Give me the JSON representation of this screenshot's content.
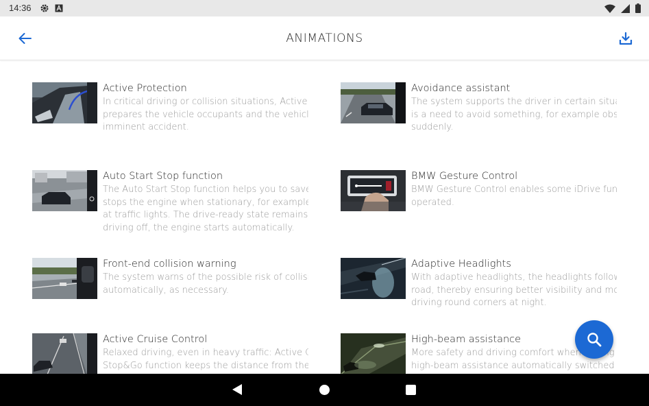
{
  "status_bar": {
    "time": "14:36",
    "left_icons": [
      "gear-icon",
      "app-a-icon"
    ],
    "right_icons": [
      "wifi-icon",
      "signal-icon",
      "battery-icon"
    ]
  },
  "app_bar": {
    "title": "ANIMATIONS",
    "back_icon": "arrow-left-icon",
    "download_icon": "download-icon"
  },
  "accent_color": "#1c69d4",
  "items": [
    {
      "title": "Active Protection",
      "description": "In critical driving or collision situations, Active Pro\nprepares the vehicle occupants and the vehicle fo\nimminent accident.",
      "thumbnail": "car-interior-seat-image"
    },
    {
      "title": "Avoidance assistant",
      "description": "The system supports the driver in certain situatio\nis a need to avoid something, for example obstac\nsuddenly.",
      "thumbnail": "car-on-road-image"
    },
    {
      "title": "Auto Start Stop function",
      "description": "The Auto Start Stop function helps you to save fu\nstops the engine when stationary, for example in\nat traffic lights. The drive-ready state remains sw\ndriving off, the engine starts automatically.",
      "thumbnail": "car-at-intersection-image"
    },
    {
      "title": "BMW Gesture Control",
      "description": "BMW Gesture Control enables some iDrive funct\noperated.",
      "thumbnail": "gesture-hand-display-image"
    },
    {
      "title": "Front-end collision warning",
      "description": "The system warns of the possible risk of collision\nautomatically, as necessary.",
      "thumbnail": "highway-traffic-image"
    },
    {
      "title": "Adaptive Headlights",
      "description": "With adaptive headlights, the headlights follow th\nroad, thereby ensuring better visibility and more\ndriving round corners at night.",
      "thumbnail": "night-headlights-image"
    },
    {
      "title": "Active Cruise Control",
      "description": "Relaxed driving, even in heavy traffic: Active Crui\nStop&Go function keeps the distance from the ve",
      "thumbnail": "cruise-road-image"
    },
    {
      "title": "High-beam assistance",
      "description": "More safety and driving comfort when driving at\nhigh-beam assistance automatically switched th",
      "thumbnail": "night-road-highbeam-image"
    }
  ],
  "fab": {
    "icon": "search-icon"
  },
  "nav_bar": {
    "icons": [
      "nav-back-icon",
      "nav-home-icon",
      "nav-recents-icon"
    ]
  }
}
